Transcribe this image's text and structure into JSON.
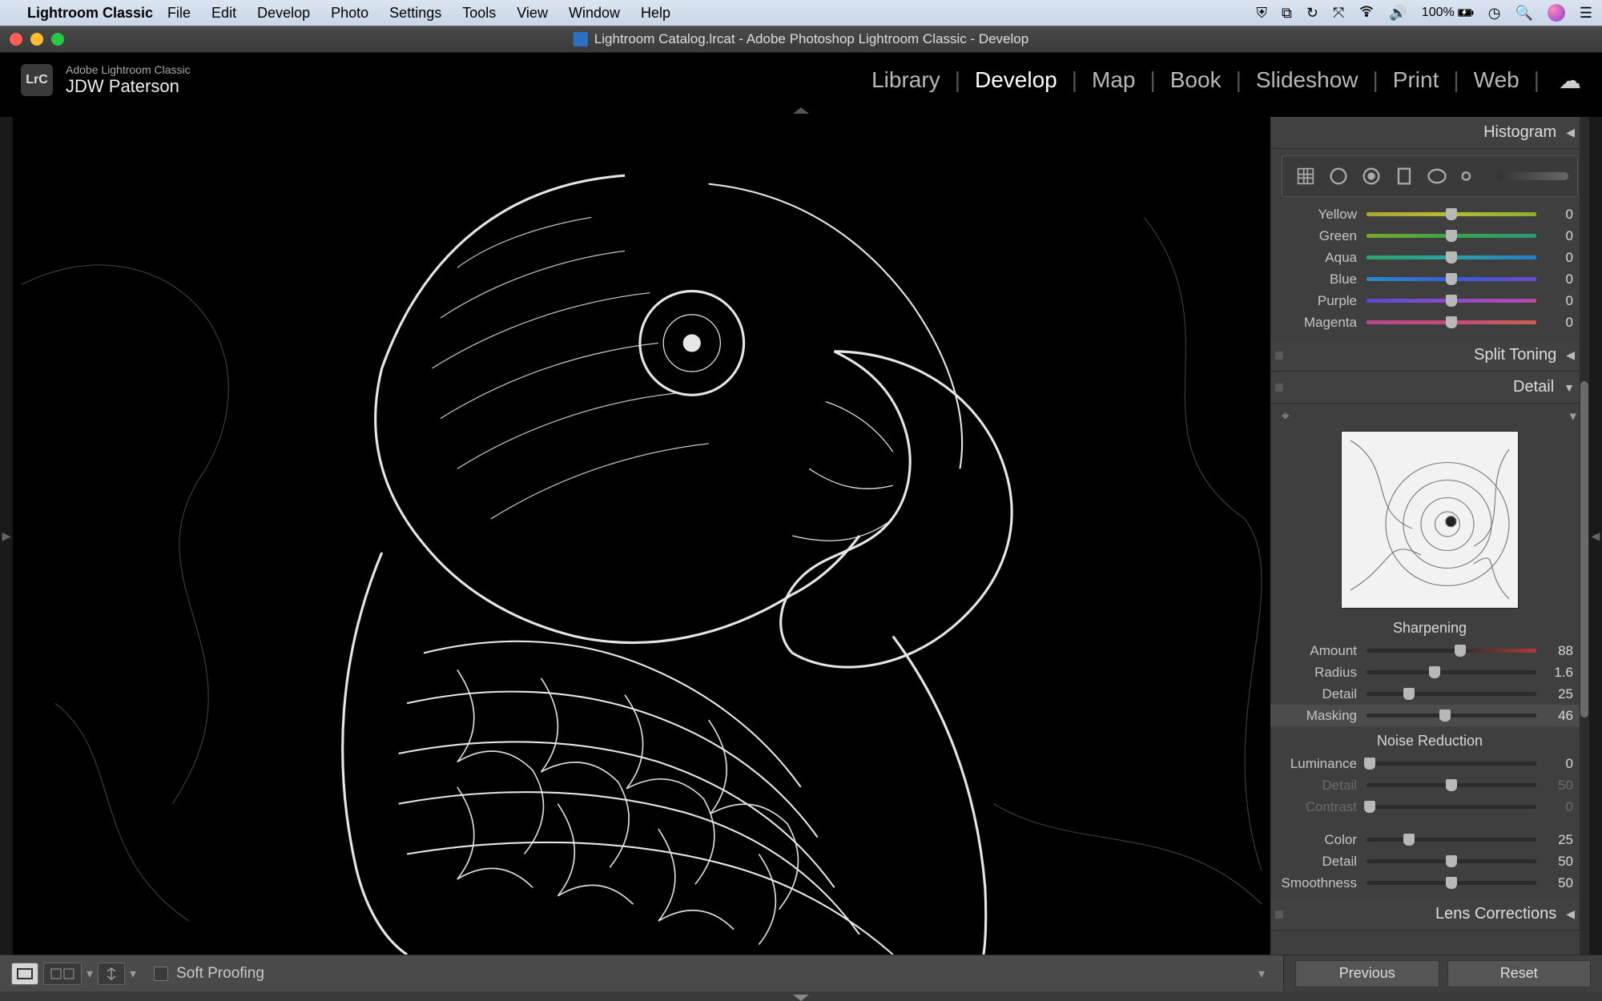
{
  "menubar": {
    "app_name": "Lightroom Classic",
    "items": [
      "File",
      "Edit",
      "Develop",
      "Photo",
      "Settings",
      "Tools",
      "View",
      "Window",
      "Help"
    ],
    "battery_pct": "100%"
  },
  "window": {
    "title": "Lightroom Catalog.lrcat - Adobe Photoshop Lightroom Classic - Develop"
  },
  "header": {
    "badge": "LrC",
    "product": "Adobe Lightroom Classic",
    "user": "JDW Paterson",
    "modules": [
      "Library",
      "Develop",
      "Map",
      "Book",
      "Slideshow",
      "Print",
      "Web"
    ],
    "active_module": "Develop"
  },
  "panels": {
    "histogram": {
      "title": "Histogram"
    },
    "hue_sliders": [
      {
        "label": "Yellow",
        "value": 0,
        "pos": 50,
        "cls": "hue-y"
      },
      {
        "label": "Green",
        "value": 0,
        "pos": 50,
        "cls": "hue-g"
      },
      {
        "label": "Aqua",
        "value": 0,
        "pos": 50,
        "cls": "hue-a"
      },
      {
        "label": "Blue",
        "value": 0,
        "pos": 50,
        "cls": "hue-b"
      },
      {
        "label": "Purple",
        "value": 0,
        "pos": 50,
        "cls": "hue-p"
      },
      {
        "label": "Magenta",
        "value": 0,
        "pos": 50,
        "cls": "hue-m"
      }
    ],
    "split_toning": {
      "title": "Split Toning"
    },
    "detail": {
      "title": "Detail",
      "sharpening": {
        "heading": "Sharpening",
        "sliders": [
          {
            "label": "Amount",
            "value": 88,
            "pos": 55,
            "cls": "sharp-amt"
          },
          {
            "label": "Radius",
            "value": "1.6",
            "pos": 40,
            "cls": "gray"
          },
          {
            "label": "Detail",
            "value": 25,
            "pos": 25,
            "cls": "gray"
          },
          {
            "label": "Masking",
            "value": 46,
            "pos": 46,
            "cls": "gray",
            "hi": true
          }
        ]
      },
      "noise_reduction": {
        "heading": "Noise Reduction",
        "sliders": [
          {
            "label": "Luminance",
            "value": 0,
            "pos": 2,
            "cls": "gray"
          },
          {
            "label": "Detail",
            "value": 50,
            "pos": 50,
            "cls": "gray",
            "dim": true
          },
          {
            "label": "Contrast",
            "value": 0,
            "pos": 2,
            "cls": "gray",
            "dim": true
          },
          {
            "label": "Color",
            "value": 25,
            "pos": 25,
            "cls": "gray",
            "gap": true
          },
          {
            "label": "Detail",
            "value": 50,
            "pos": 50,
            "cls": "gray"
          },
          {
            "label": "Smoothness",
            "value": 50,
            "pos": 50,
            "cls": "gray"
          }
        ]
      }
    },
    "lens_corrections": {
      "title": "Lens Corrections"
    }
  },
  "toolbar": {
    "soft_proofing": "Soft Proofing",
    "previous": "Previous",
    "reset": "Reset"
  }
}
